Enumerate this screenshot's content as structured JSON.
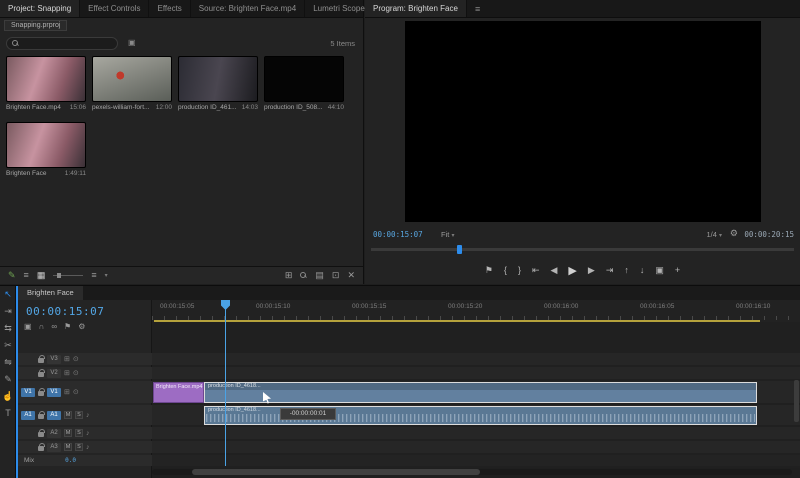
{
  "glyphs": {
    "menu": "≡",
    "chevron": "▾",
    "gear": "⚙",
    "sync": "⊞",
    "eye": "⊙",
    "note": "♪",
    "flag": "⚑",
    "magnet": "∩",
    "nest": "▣",
    "link": "∞",
    "filter": "▣"
  },
  "project": {
    "tabs": [
      "Project: Snapping",
      "Effect Controls",
      "Effects",
      "Source: Brighten Face.mp4",
      "Lumetri Scopes"
    ],
    "project_name": "Snapping.prproj",
    "search_placeholder": "",
    "items_count": "5 Items",
    "items": [
      {
        "name": "Brighten Face.mp4",
        "duration": "15:06"
      },
      {
        "name": "pexels-william-fort...",
        "duration": "12:00"
      },
      {
        "name": "production ID_461...",
        "duration": "14:03"
      },
      {
        "name": "production ID_508...",
        "duration": "44:10"
      },
      {
        "name": "Brighten Face",
        "duration": "1:49:11"
      }
    ],
    "toolbar": {
      "writable": "✎",
      "list_view": "≡",
      "icon_view": "▦",
      "sort": "≡",
      "automate": "⊞",
      "new_bin": "▤",
      "new_item": "⊡",
      "delete": "✕"
    }
  },
  "program": {
    "tab": "Program: Brighten Face",
    "current_time": "00:00:15:07",
    "fit": "Fit",
    "resolution": "1/4",
    "duration": "00:00:20:15",
    "transport": [
      {
        "glyph": "⚑"
      },
      {
        "glyph": "{"
      },
      {
        "glyph": "}"
      },
      {
        "glyph": "⇤"
      },
      {
        "glyph": "◀"
      },
      {
        "glyph": "▶"
      },
      {
        "glyph": "▶"
      },
      {
        "glyph": "⇥"
      },
      {
        "glyph": "↑"
      },
      {
        "glyph": "↓"
      },
      {
        "glyph": "▣"
      },
      {
        "glyph": "+"
      }
    ]
  },
  "tools": [
    {
      "glyph": "↖"
    },
    {
      "glyph": "⇥"
    },
    {
      "glyph": "⇆"
    },
    {
      "glyph": "✂"
    },
    {
      "glyph": "⇋"
    },
    {
      "glyph": "✎"
    },
    {
      "glyph": "☝"
    },
    {
      "glyph": "T"
    }
  ],
  "timeline": {
    "tab": "Brighten Face",
    "timecode": "00:00:15:07",
    "ruler_labels": [
      "00:00:15:05",
      "00:00:15:10",
      "00:00:15:15",
      "00:00:15:20",
      "00:00:16:00",
      "00:00:16:05",
      "00:00:16:10"
    ],
    "tracks": {
      "video": [
        {
          "name": "V3"
        },
        {
          "name": "V2"
        },
        {
          "name": "V1",
          "targeted": true
        }
      ],
      "audio": [
        {
          "name": "A1",
          "targeted": true
        },
        {
          "name": "A2"
        },
        {
          "name": "A3"
        }
      ],
      "master_label": "Mix",
      "master_level": "0.0",
      "mute_label": "M",
      "solo_label": "S"
    },
    "clips": {
      "v1_left": {
        "name": "Brighten Face.mp4"
      },
      "v1_main": {
        "name": "production ID_4618..."
      },
      "a1_main": {
        "name": "production ID_4618..."
      }
    },
    "drag_tooltip": "-00:00:00:01"
  },
  "colors": {
    "accent": "#2d8ceb",
    "timecode_blue": "#58a6e0",
    "target_blue": "#3f74a8",
    "clip_blue": "#62809f",
    "clip_purple": "#9d6cc3",
    "workarea_yellow": "#b5a23c"
  }
}
